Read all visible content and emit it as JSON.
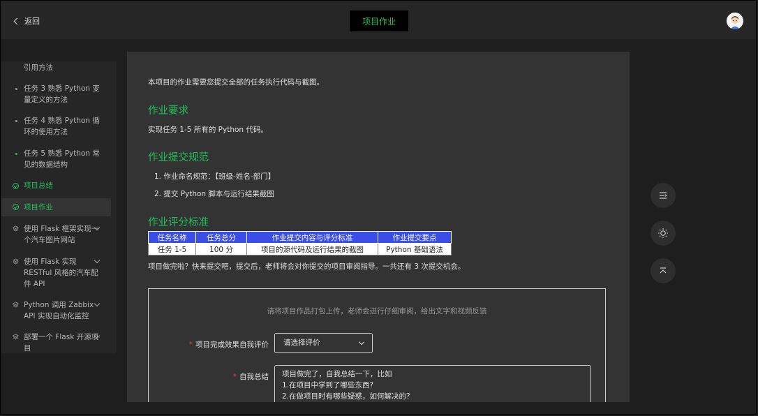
{
  "header": {
    "back_label": "返回",
    "title": "项目作业"
  },
  "sidebar": {
    "items": [
      {
        "label": "引用方法"
      },
      {
        "label": "任务 3 熟悉 Python 变量定义的方法"
      },
      {
        "label": "任务 4 熟悉 Python 循环的使用方法"
      },
      {
        "label": "任务 5 熟悉 Python 常见的数据结构"
      },
      {
        "label": "项目总结"
      },
      {
        "label": "项目作业"
      },
      {
        "label": "使用 Flask 框架实现一个汽车图片网站"
      },
      {
        "label": "使用 Flask 实现 RESTful 风格的汽车配件 API"
      },
      {
        "label": "Python 调用 Zabbix API 实现自动化监控"
      },
      {
        "label": "部署一个 Flask 开源项目"
      }
    ]
  },
  "content": {
    "intro": "本项目的作业需要您提交全部的任务执行代码与截图。",
    "req_heading": "作业要求",
    "req_text": "实现任务 1-5 所有的 Python 代码。",
    "spec_heading": "作业提交规范",
    "spec_items": [
      "1. 作业命名规范：【班级-姓名-部门】",
      "2. 提交 Python 脚本与运行结果截图"
    ],
    "grade_heading": "作业评分标准",
    "table": {
      "headers": [
        "任务名称",
        "任务总分",
        "作业提交内容与评分标准",
        "作业提交要点"
      ],
      "rows": [
        [
          "任务 1-5",
          "100 分",
          "项目的源代码及运行结果的截图",
          "Python 基础语法"
        ]
      ]
    },
    "note": "项目做完啦？快来提交吧，提交后，老师将会对你提交的项目审阅指导。一共还有 3 次提交机会。"
  },
  "upload": {
    "hint": "请将项目作品打包上传，老师会进行仔细审阅，给出文字和视频反馈",
    "required_mark": "*",
    "rating_label": "项目完成效果自我评价",
    "rating_placeholder": "请选择评价",
    "summary_label": "自我总结",
    "summary_lines": [
      "项目做完了，自我总结一下，比如",
      "1.在项目中学到了哪些东西?",
      "2.在做项目时有哪些疑惑，如何解决的?"
    ]
  },
  "colors": {
    "accent": "#21c05a",
    "table_header": "#3a4de6",
    "required": "#e0463e"
  },
  "icons": [
    "chevron-left-icon",
    "avatar-icon",
    "outline-icon",
    "sun-icon",
    "back-to-top-icon"
  ]
}
